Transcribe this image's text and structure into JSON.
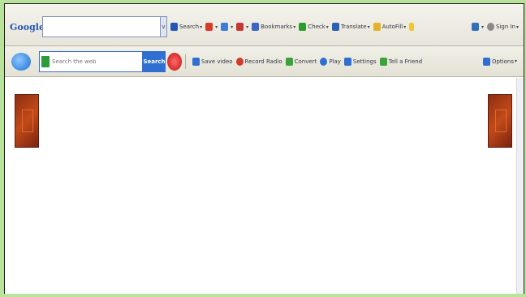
{
  "toolbar_google": {
    "logo": "Google",
    "search_value": "",
    "buttons": [
      {
        "label": "Search",
        "color": "#2457b9"
      },
      {
        "label": "",
        "color": "#d83b2a"
      },
      {
        "label": "",
        "color": "#3d7bd6"
      },
      {
        "label": "",
        "color": "#c93636"
      },
      {
        "label": "Bookmarks",
        "color": "#3d66c9"
      },
      {
        "label": "Check",
        "color": "#2f9b2f"
      },
      {
        "label": "Translate",
        "color": "#2e5fb7"
      },
      {
        "label": "AutoFill",
        "color": "#e3b12a"
      },
      {
        "label": "",
        "color": "#f0c43a"
      }
    ],
    "right": [
      {
        "label": "",
        "color": "#2e6fbf"
      },
      {
        "label": "Sign In",
        "color": "#8a8a8a"
      }
    ]
  },
  "toolbar_second": {
    "search_placeholder": "Search the web",
    "search_label": "Search",
    "actions": [
      {
        "label": "Save video",
        "color": "#2f6fd1"
      },
      {
        "label": "Record Radio",
        "color": "#d23b2a"
      },
      {
        "label": "Convert",
        "color": "#3aa43a"
      },
      {
        "label": "Play",
        "color": "#2f6fd1"
      },
      {
        "label": "Settings",
        "color": "#2f6fd1"
      },
      {
        "label": "Tell a Friend",
        "color": "#3aa43a"
      }
    ],
    "options_label": "Options"
  }
}
